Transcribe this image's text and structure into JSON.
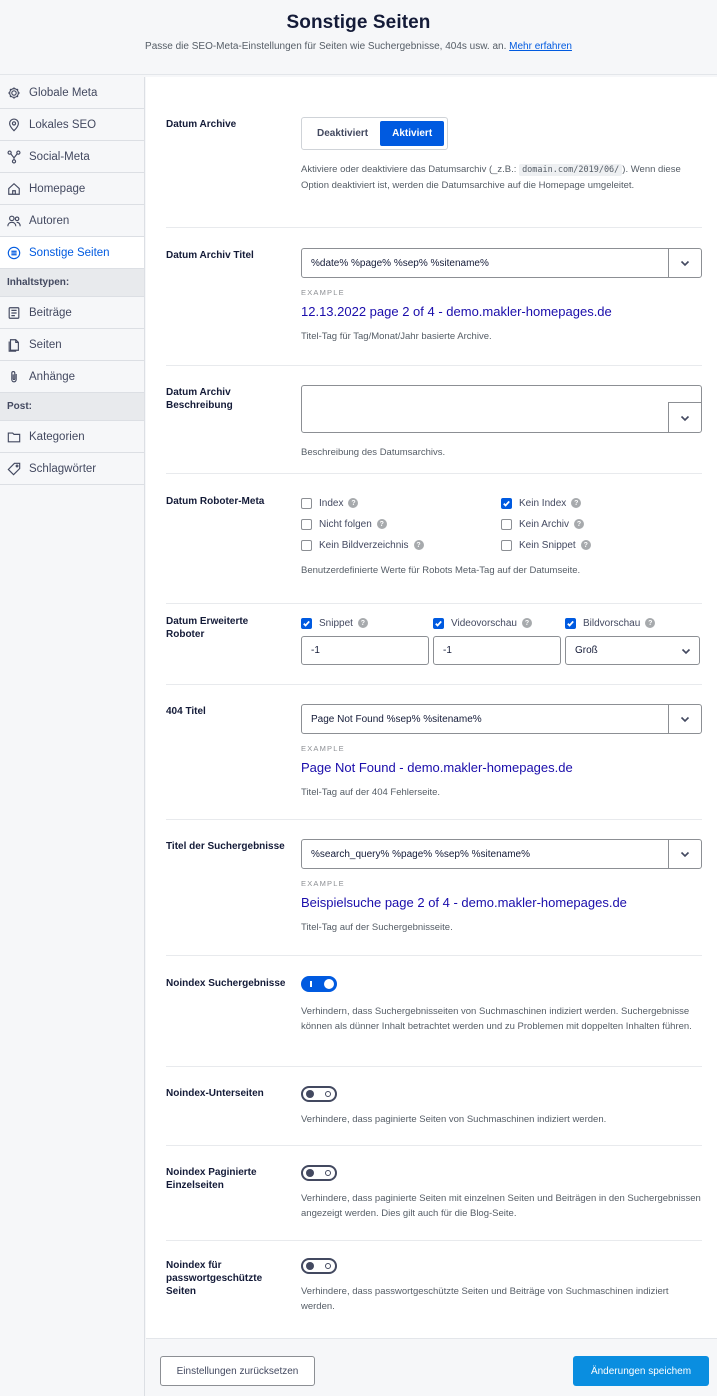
{
  "header": {
    "title": "Sonstige Seiten",
    "subtitle": "Passe die SEO-Meta-Einstellungen für Seiten wie Suchergebnisse, 404s usw. an.",
    "learn_more": "Mehr erfahren"
  },
  "sidebar": {
    "items": [
      {
        "label": "Globale Meta",
        "icon": "gear-icon"
      },
      {
        "label": "Lokales SEO",
        "icon": "location-pin-icon"
      },
      {
        "label": "Social-Meta",
        "icon": "share-icon"
      },
      {
        "label": "Homepage",
        "icon": "home-icon"
      },
      {
        "label": "Autoren",
        "icon": "users-icon"
      },
      {
        "label": "Sonstige Seiten",
        "icon": "list-circle-icon",
        "active": true
      }
    ],
    "section_content_types": "Inhaltstypen:",
    "content_items": [
      {
        "label": "Beiträge",
        "icon": "post-icon"
      },
      {
        "label": "Seiten",
        "icon": "pages-icon"
      },
      {
        "label": "Anhänge",
        "icon": "paperclip-icon"
      }
    ],
    "section_post": "Post:",
    "post_items": [
      {
        "label": "Kategorien",
        "icon": "folder-icon"
      },
      {
        "label": "Schlagwörter",
        "icon": "tag-icon"
      }
    ]
  },
  "date_archives": {
    "label": "Datum Archive",
    "off": "Deaktiviert",
    "on": "Aktiviert",
    "desc_pre": "Aktiviere oder deaktiviere das Datumsarchiv (_z.B.:",
    "desc_code": "domain.com/2019/06/",
    "desc_post": "). Wenn diese Option deaktiviert ist, werden die Datumsarchive auf die Homepage umgeleitet."
  },
  "date_archive_title": {
    "label": "Datum Archiv Titel",
    "value": "%date% %page% %sep% %sitename%",
    "example_label": "EXAMPLE",
    "example": "12.13.2022 page 2 of 4 - demo.makler-homepages.de",
    "desc": "Titel-Tag für Tag/Monat/Jahr basierte Archive."
  },
  "date_archive_desc": {
    "label": "Datum Archiv Beschreibung",
    "value": "",
    "desc": "Beschreibung des Datumsarchivs."
  },
  "robots": {
    "label": "Datum Roboter-Meta",
    "options": [
      {
        "label": "Index",
        "checked": false
      },
      {
        "label": "Kein Index",
        "checked": true
      },
      {
        "label": "Nicht folgen",
        "checked": false
      },
      {
        "label": "Kein Archiv",
        "checked": false
      },
      {
        "label": "Kein Bildverzeichnis",
        "checked": false
      },
      {
        "label": "Kein Snippet",
        "checked": false
      }
    ],
    "desc": "Benutzerdefinierte Werte für Robots Meta-Tag auf der Datumseite."
  },
  "advanced_robots": {
    "label": "Datum Erweiterte Roboter",
    "snippet_label": "Snippet",
    "video_label": "Videovorschau",
    "image_label": "Bildvorschau",
    "snippet_value": "-1",
    "video_value": "-1",
    "image_value": "Groß"
  },
  "title_404": {
    "label": "404 Titel",
    "value": "Page Not Found %sep% %sitename%",
    "example_label": "EXAMPLE",
    "example": "Page Not Found - demo.makler-homepages.de",
    "desc": "Titel-Tag auf der 404 Fehlerseite."
  },
  "search_title": {
    "label": "Titel der Suchergebnisse",
    "value": "%search_query% %page% %sep% %sitename%",
    "example_label": "EXAMPLE",
    "example": "Beispielsuche page 2 of 4 - demo.makler-homepages.de",
    "desc": "Titel-Tag auf der Suchergebnisseite."
  },
  "noindex_search": {
    "label": "Noindex Suchergebnisse",
    "on": true,
    "desc": "Verhindern, dass Suchergebnisseiten von Suchmaschinen indiziert werden. Suchergebnisse können als dünner Inhalt betrachtet werden und zu Problemen mit doppelten Inhalten führen."
  },
  "noindex_subpages": {
    "label": "Noindex-Unterseiten",
    "on": false,
    "desc": "Verhindere, dass paginierte Seiten von Suchmaschinen indiziert werden."
  },
  "noindex_paginated": {
    "label": "Noindex Paginierte Einzelseiten",
    "on": false,
    "desc": "Verhindere, dass paginierte Seiten mit einzelnen Seiten und Beiträgen in den Suchergebnissen angezeigt werden. Dies gilt auch für die Blog-Seite."
  },
  "noindex_password": {
    "label": "Noindex für passwortgeschützte Seiten",
    "on": false,
    "desc": "Verhindere, dass passwortgeschützte Seiten und Beiträge von Suchmaschinen indiziert werden."
  },
  "footer": {
    "reset": "Einstellungen zurücksetzen",
    "save": "Änderungen speichem"
  }
}
